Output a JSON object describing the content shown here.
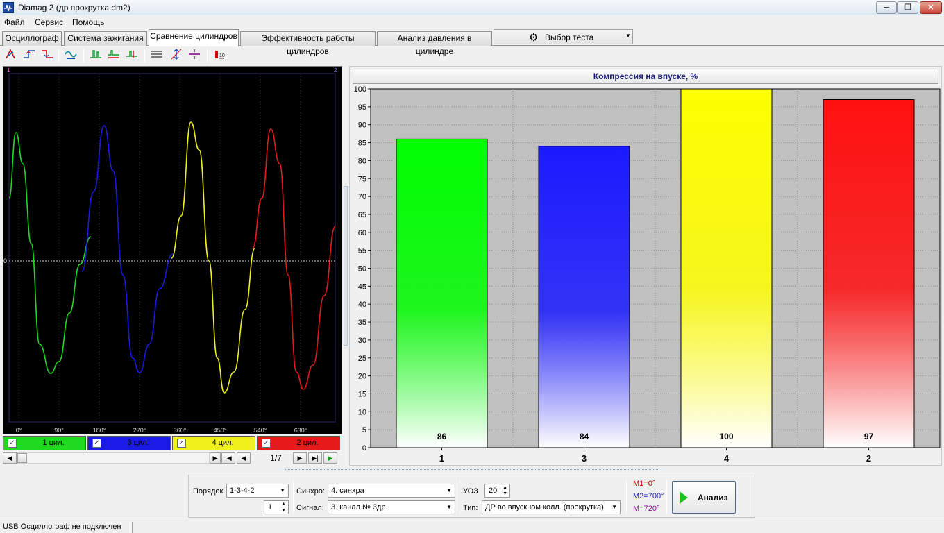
{
  "window": {
    "title": "Diamag 2 (др прокрутка.dm2)",
    "min": "─",
    "max": "❐",
    "close": "✕"
  },
  "menu": [
    "Файл",
    "Сервис",
    "Помощь"
  ],
  "tabs": [
    {
      "label": "Осциллограф",
      "active": false
    },
    {
      "label": "Система зажигания",
      "active": false
    },
    {
      "label": "Сравнение цилиндров",
      "active": true
    },
    {
      "label": "Эффективность работы цилиндров",
      "active": false
    },
    {
      "label": "Анализ давления в цилиндре",
      "active": false
    }
  ],
  "test_select": {
    "label": "Выбор теста",
    "icon": "gear-icon"
  },
  "oscilloscope": {
    "markers": [
      "1",
      "2"
    ],
    "zero_label": "0",
    "x_ticks": [
      "0°",
      "90°",
      "180°",
      "270°",
      "360°",
      "450°",
      "540°",
      "630°"
    ],
    "cylinders": [
      {
        "label": "1 цил.",
        "color": "#1ed91e",
        "checked": true
      },
      {
        "label": "3 цил.",
        "color": "#1a1ae6",
        "checked": true
      },
      {
        "label": "4 цил.",
        "color": "#f0f01a",
        "checked": true
      },
      {
        "label": "2 цил.",
        "color": "#e61a1a",
        "checked": true
      }
    ],
    "page": "1/7"
  },
  "chart_data": {
    "type": "bar",
    "title": "Компрессия на впуске, %",
    "categories": [
      "1",
      "3",
      "4",
      "2"
    ],
    "values": [
      86,
      84,
      100,
      97
    ],
    "colors": [
      "#00ff00",
      "#1a1aff",
      "#ffff00",
      "#ff1010"
    ],
    "ylim": [
      0,
      100
    ],
    "yticks": [
      0,
      5,
      10,
      15,
      20,
      25,
      30,
      35,
      40,
      45,
      50,
      55,
      60,
      65,
      70,
      75,
      80,
      85,
      90,
      95,
      100
    ],
    "grid": true
  },
  "controls": {
    "order_label": "Порядок",
    "order_value": "1-3-4-2",
    "order_spin": "1",
    "sync_label": "Синхро:",
    "sync_value": "4.  синхра",
    "signal_label": "Сигнал:",
    "signal_value": "3.  канал № 3др",
    "uoz_label": "УОЗ",
    "uoz_value": "20",
    "type_label": "Тип:",
    "type_value": "ДР во впускном колл. (прокрутка)",
    "m1": "M1=0°",
    "m2": "M2=700°",
    "m3": "M=720°",
    "analyze": "Анализ"
  },
  "status": {
    "text": "USB Осциллограф не подключен"
  }
}
